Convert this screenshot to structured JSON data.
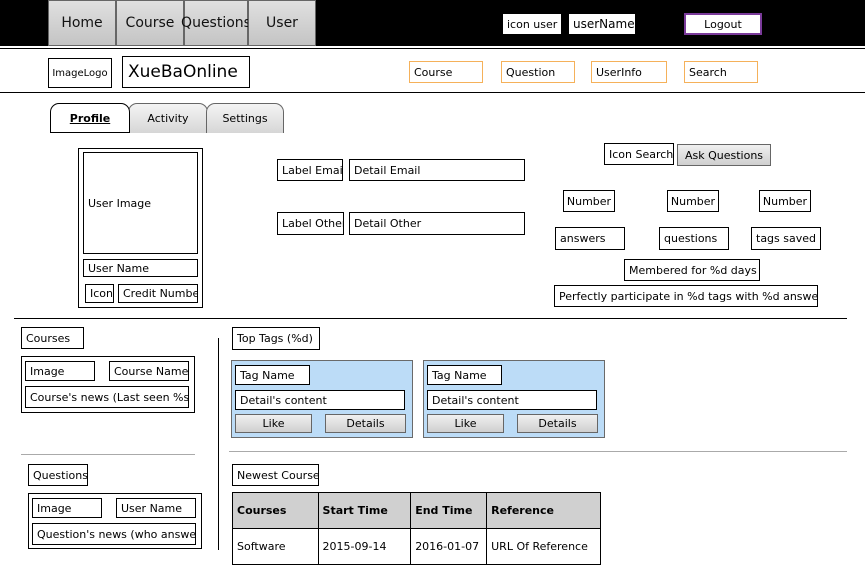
{
  "nav": {
    "home": "Home",
    "course": "Course",
    "questions": "Questions",
    "user": "User",
    "icon_user": "icon user",
    "username": "userName",
    "logout": "Logout"
  },
  "header": {
    "image_logo": "ImageLogo",
    "site_title": "XueBaOnline",
    "links": {
      "course": "Course",
      "question": "Question",
      "userinfo": "UserInfo",
      "search": "Search"
    }
  },
  "tabs": {
    "profile": "Profile",
    "activity": "Activity",
    "settings": "Settings"
  },
  "profile": {
    "user_image": "User Image",
    "user_name": "User Name",
    "icon": "Icon",
    "credit_number": "Credit Number",
    "label_email": "Label Email",
    "detail_email": "Detail Email",
    "label_other": "Label Other",
    "detail_other": "Detail Other"
  },
  "stats": {
    "icon_search": "Icon Search",
    "ask_questions": "Ask Questions",
    "number_1": "Number",
    "number_2": "Number",
    "number_3": "Number",
    "answers": "answers",
    "questions": "questions",
    "tags_saved": "tags saved",
    "membered": "Membered for %d days",
    "participate": "Perfectly participate in %d tags with %d answers"
  },
  "courses_panel": {
    "title": "Courses",
    "image": "Image",
    "course_name": "Course Name",
    "news": "Course's news (Last seen %s)"
  },
  "questions_panel": {
    "title": "Questions",
    "image": "Image",
    "user_name": "User Name",
    "news": "Question's news (who answered)"
  },
  "top_tags": {
    "title": "Top Tags (%d)",
    "cards": [
      {
        "tag_name": "Tag Name",
        "detail": "Detail's content",
        "like": "Like",
        "details": "Details"
      },
      {
        "tag_name": "Tag Name",
        "detail": "Detail's content",
        "like": "Like",
        "details": "Details"
      }
    ]
  },
  "newest_courses": {
    "title": "Newest Courses",
    "headers": [
      "Courses",
      "Start Time",
      "End Time",
      "Reference"
    ],
    "rows": [
      [
        "Software",
        "2015-09-14",
        "2016-01-07",
        "URL Of Reference"
      ]
    ]
  }
}
